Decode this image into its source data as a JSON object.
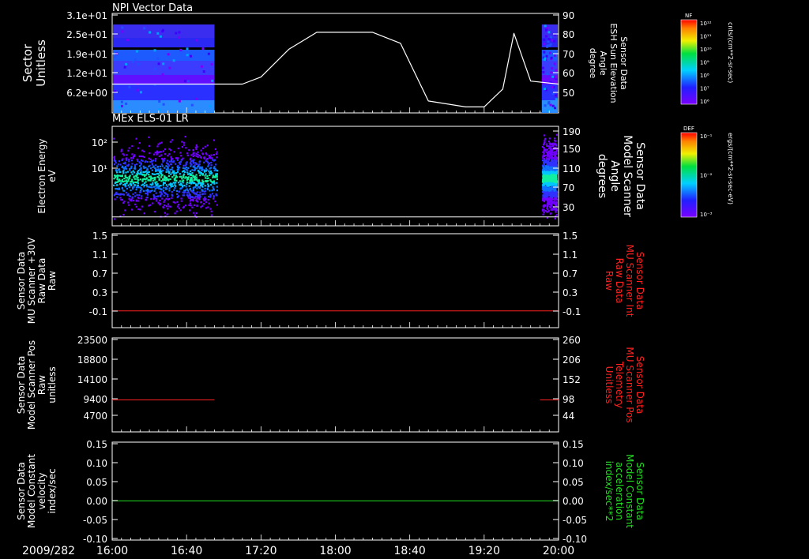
{
  "chart_data": [
    {
      "type": "heatmap",
      "title": "NPI Vector Data",
      "ylabel_lines": [
        "Sector",
        "Unitless"
      ],
      "yticks": [
        "3.1e+01",
        "2.5e+01",
        "1.9e+01",
        "1.2e+01",
        "6.2e+00"
      ],
      "overlay_series": {
        "ylabel_lines": [
          "Sensor Data",
          "ESH Sun Elevation",
          "Angle",
          "degree"
        ],
        "yticks": [
          "90",
          "80",
          "70",
          "60",
          "50"
        ],
        "ylim": [
          40,
          90
        ],
        "x": [
          "16:00",
          "16:40",
          "17:10",
          "17:20",
          "17:35",
          "17:50",
          "18:20",
          "18:35",
          "18:50",
          "19:10",
          "19:20",
          "19:30",
          "19:36",
          "19:45",
          "20:00"
        ],
        "values": [
          54.5,
          54.5,
          54.5,
          58,
          72,
          80.5,
          80.5,
          75,
          46,
          43,
          43,
          52,
          80,
          56,
          54.5
        ],
        "color": "#ffffff"
      },
      "colorbar": {
        "label": "NF",
        "units": "cnts/(cm**2-sr-sec)",
        "tick_labels": [
          "10¹²",
          "10¹¹",
          "10¹⁰",
          "10⁹",
          "10⁸",
          "10⁷",
          "10⁶"
        ]
      }
    },
    {
      "type": "heatmap",
      "title": "MEx ELS-01 LR",
      "ylabel_lines": [
        "Electron Energy",
        "eV"
      ],
      "yticks": [
        "10²",
        "10¹"
      ],
      "overlay_series": {
        "ylabel_lines": [
          "Sensor Data",
          "Model Scanner",
          "Angle",
          "degrees"
        ],
        "yticks": [
          "190",
          "150",
          "110",
          "70",
          "30"
        ],
        "ylim": [
          0,
          190
        ],
        "values_constant": 20,
        "color": "#ffffff"
      },
      "colorbar": {
        "label": "DEF",
        "units": "ergs/(cm**2-sr-sec-eV)",
        "tick_labels": [
          "10⁻¹",
          "10⁻²",
          "10⁻³"
        ]
      }
    },
    {
      "type": "line",
      "ylabel_lines": [
        "Sensor Data",
        "MU Scanner +30V",
        "Raw Data",
        "Raw"
      ],
      "yticks": [
        "1.5",
        "1.1",
        "0.7",
        "0.3",
        "-0.1"
      ],
      "ylim": [
        -0.4,
        1.5
      ],
      "right_ylabel_lines": [
        "Sensor Data",
        "MU Scanner Int",
        "Raw Data",
        "Raw"
      ],
      "right_yticks": [
        "1.5",
        "1.1",
        "0.7",
        "0.3",
        "-0.1"
      ],
      "series": [
        {
          "x_range": [
            "16:00",
            "20:00"
          ],
          "value": -0.06,
          "color": "#ff2020"
        }
      ]
    },
    {
      "type": "line",
      "ylabel_lines": [
        "Sensor Data",
        "Model Scanner Pos",
        "Raw",
        "unitless"
      ],
      "yticks": [
        "23500",
        "18800",
        "14100",
        "9400",
        "4700"
      ],
      "ylim": [
        0,
        23500
      ],
      "right_ylabel_lines": [
        "Sensor Data",
        "MU Scanner Pos",
        "Telemetry",
        "Unitless"
      ],
      "right_yticks": [
        "260",
        "206",
        "152",
        "98",
        "44"
      ],
      "series": [
        {
          "x_range": [
            "16:00",
            "16:55"
          ],
          "value": 8000,
          "color": "#ff2020"
        },
        {
          "x_range": [
            "19:50",
            "20:00"
          ],
          "value": 8000,
          "color": "#ff2020"
        }
      ]
    },
    {
      "type": "line",
      "ylabel_lines": [
        "Sensor Data",
        "Model Constant",
        "velocity",
        "index/sec"
      ],
      "yticks": [
        "0.15",
        "0.10",
        "0.05",
        "0.00",
        "-0.05",
        "-0.10"
      ],
      "ylim": [
        -0.1,
        0.15
      ],
      "right_ylabel_lines": [
        "Sensor Data",
        "Model Constant",
        "acceleration",
        "index/sec**2"
      ],
      "right_yticks": [
        "0.15",
        "0.10",
        "0.05",
        "0.00",
        "-0.05",
        "-0.10"
      ],
      "series": [
        {
          "x_range": [
            "16:00",
            "20:00"
          ],
          "value": 0.0,
          "color": "#20e020"
        }
      ]
    }
  ],
  "xaxis": {
    "date": "2009/282",
    "ticks": [
      "16:00",
      "16:40",
      "17:20",
      "18:00",
      "18:40",
      "19:20",
      "20:00"
    ],
    "range": [
      "16:00",
      "20:00"
    ]
  }
}
